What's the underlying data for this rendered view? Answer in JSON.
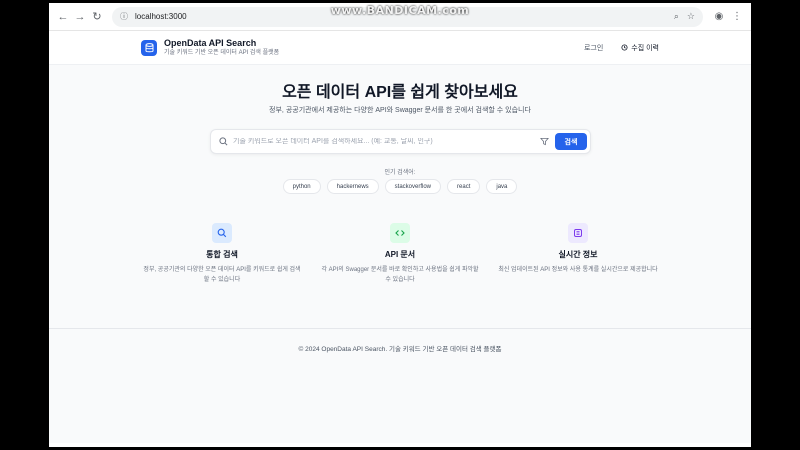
{
  "watermark": "www.BANDICAM.com",
  "browser": {
    "url": "localhost:3000"
  },
  "header": {
    "title": "OpenData API Search",
    "subtitle": "기술 키워드 기반 오픈 데이터 API 검색 플랫폼",
    "login_label": "로그인",
    "history_label": "수집 이력"
  },
  "hero": {
    "title": "오픈 데이터 API를 쉽게 찾아보세요",
    "subtitle": "정부, 공공기관에서 제공하는 다양한 API와 Swagger 문서를 한 곳에서 검색할 수 있습니다"
  },
  "search": {
    "placeholder": "기술 키워드로 오픈 데이터 API를 검색하세요... (예: 교통, 날씨, 인구)",
    "button_label": "검색"
  },
  "popular": {
    "label": "인기 검색어:",
    "tags": [
      "python",
      "hackernews",
      "stackoverflow",
      "react",
      "java"
    ]
  },
  "features": [
    {
      "icon": "search-icon",
      "title": "통합 검색",
      "desc": "정부, 공공기관의 다양한 오픈 데이터 API를 키워드로 쉽게 검색할 수 있습니다",
      "bg": "#dbeafe",
      "color": "#2563eb"
    },
    {
      "icon": "code-icon",
      "title": "API 문서",
      "desc": "각 API의 Swagger 문서를 바로 확인하고 사용법을 쉽게 파악할 수 있습니다",
      "bg": "#dcfce7",
      "color": "#16a34a"
    },
    {
      "icon": "database-icon",
      "title": "실시간 정보",
      "desc": "최신 업데이트된 API 정보와 사용 통계를 실시간으로 제공합니다",
      "bg": "#ede9fe",
      "color": "#7c3aed"
    }
  ],
  "footer": {
    "text": "© 2024 OpenData API Search. 기술 키워드 기반 오픈 데이터 검색 플랫폼"
  },
  "colors": {
    "accent": "#2563eb",
    "background": "#f9fafb"
  }
}
